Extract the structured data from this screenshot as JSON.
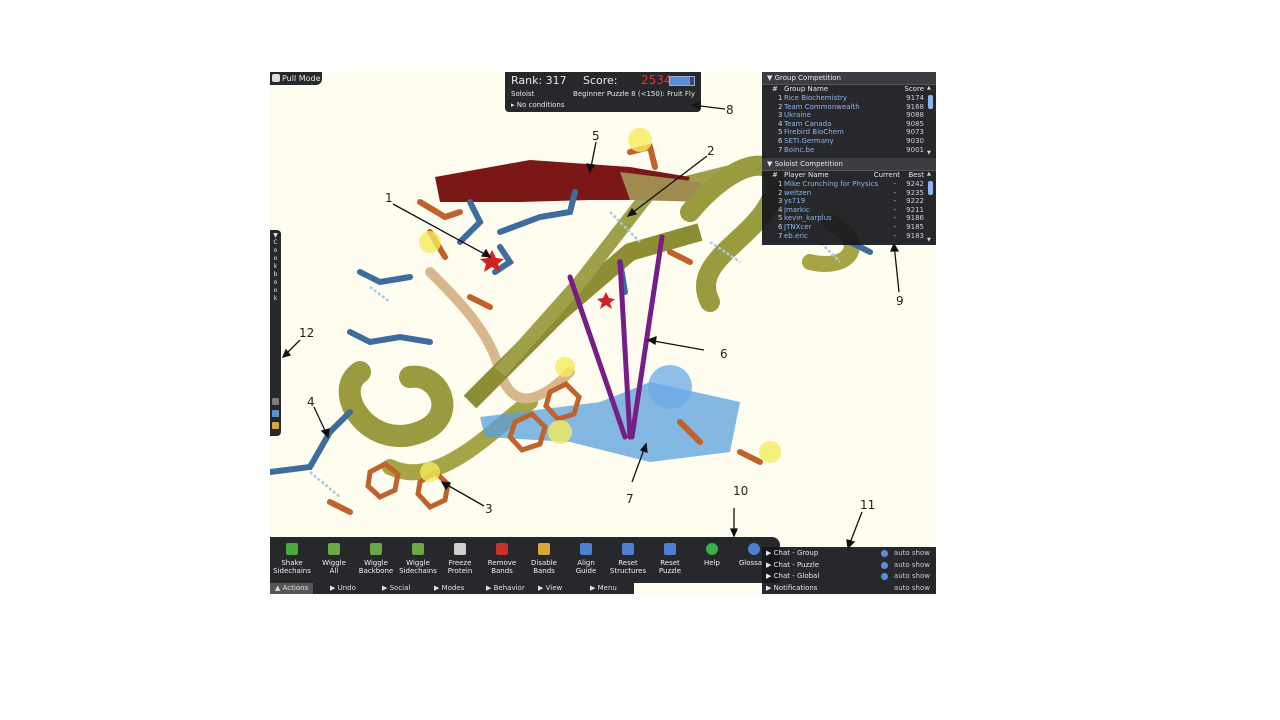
{
  "pull_mode": {
    "label": "Pull Mode"
  },
  "score_panel": {
    "rank_label": "Rank: 317",
    "score_label": "Score:",
    "score_value": "2534",
    "score_bar_fraction": 0.85,
    "role": "Soloist",
    "puzzle": "Beginner Puzzle 8 (<150): Fruit Fly",
    "conditions": "No conditions"
  },
  "cookbook": {
    "label": "Cookbook"
  },
  "group_competition": {
    "title": "Group Competition",
    "col_num": "#",
    "col_name": "Group Name",
    "col_score": "Score",
    "rows": [
      {
        "rank": "1",
        "name": "Rice Biochemistry",
        "score": "9174"
      },
      {
        "rank": "2",
        "name": "Team Commonwealth",
        "score": "9168"
      },
      {
        "rank": "3",
        "name": "Ukraine",
        "score": "9088"
      },
      {
        "rank": "4",
        "name": "Team Canada",
        "score": "9085"
      },
      {
        "rank": "5",
        "name": "Firebird BioChem",
        "score": "9073"
      },
      {
        "rank": "6",
        "name": "SETI.Germany",
        "score": "9030"
      },
      {
        "rank": "7",
        "name": "Boinc.be",
        "score": "9001"
      }
    ]
  },
  "soloist_competition": {
    "title": "Soloist Competition",
    "col_num": "#",
    "col_name": "Player Name",
    "col_current": "Current",
    "col_best": "Best",
    "rows": [
      {
        "rank": "1",
        "name": "Mike Crunching for Physics",
        "current": "-",
        "best": "9242"
      },
      {
        "rank": "2",
        "name": "weitzen",
        "current": "-",
        "best": "9235"
      },
      {
        "rank": "3",
        "name": "ys719",
        "current": "-",
        "best": "9222"
      },
      {
        "rank": "4",
        "name": "jmarkic",
        "current": "-",
        "best": "9211"
      },
      {
        "rank": "5",
        "name": "kevin_karplus",
        "current": "-",
        "best": "9186"
      },
      {
        "rank": "6",
        "name": "JTNXcer",
        "current": "-",
        "best": "9185"
      },
      {
        "rank": "7",
        "name": "eb.eric",
        "current": "-",
        "best": "9183"
      }
    ]
  },
  "toolbar": {
    "buttons": [
      {
        "line1": "Shake",
        "line2": "Sidechains",
        "color": "#4caa3c"
      },
      {
        "line1": "Wiggle",
        "line2": "All",
        "color": "#6aa846"
      },
      {
        "line1": "Wiggle",
        "line2": "Backbone",
        "color": "#6aa846"
      },
      {
        "line1": "Wiggle",
        "line2": "Sidechains",
        "color": "#6aa846"
      },
      {
        "line1": "Freeze",
        "line2": "Protein",
        "color": "#cfcfcf"
      },
      {
        "line1": "Remove",
        "line2": "Bands",
        "color": "#c93030"
      },
      {
        "line1": "Disable",
        "line2": "Bands",
        "color": "#d8a73b"
      },
      {
        "line1": "Align",
        "line2": "Guide",
        "color": "#4e7fd0"
      },
      {
        "line1": "Reset",
        "line2": "Structures",
        "color": "#4e7fd0"
      },
      {
        "line1": "Reset",
        "line2": "Puzzle",
        "color": "#4e7fd0"
      },
      {
        "line1": "Help",
        "line2": "",
        "color": "#3fae4a"
      },
      {
        "line1": "Glossary",
        "line2": "",
        "color": "#4e7fd0"
      }
    ]
  },
  "menu_bar": {
    "actions": "Actions",
    "undo": "Undo",
    "social": "Social",
    "modes": "Modes",
    "behavior": "Behavior",
    "view": "View",
    "menu": "Menu"
  },
  "chat": {
    "rows": [
      {
        "label": "Chat - Group",
        "setting": "auto show"
      },
      {
        "label": "Chat - Puzzle",
        "setting": "auto show"
      },
      {
        "label": "Chat - Global",
        "setting": "auto show"
      },
      {
        "label": "Notifications",
        "setting": "auto show"
      }
    ]
  },
  "annotations": [
    "1",
    "2",
    "3",
    "4",
    "5",
    "6",
    "7",
    "8",
    "9",
    "10",
    "11",
    "12"
  ]
}
